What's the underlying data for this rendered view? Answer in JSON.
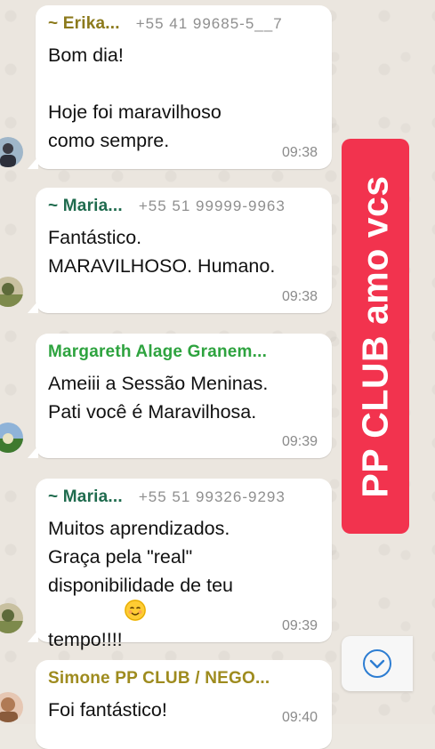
{
  "messages": [
    {
      "sender": "~ Erika...",
      "sender_color": "#8c7a1c",
      "phone": "+55 41 99685-5__7",
      "text": "Bom dia!\n\nHoje foi maravilhoso\ncomo sempre.",
      "time": "09:38"
    },
    {
      "sender": "~ Maria...",
      "sender_color": "#1f6b4e",
      "phone": "+55 51 99999-9963",
      "text": "Fantástico.\nMARAVILHOSO. Humano.",
      "time": "09:38"
    },
    {
      "sender": "Margareth Alage Granem...",
      "sender_color": "#2ea33f",
      "phone": "",
      "text": "Ameiii a Sessão Meninas.\nPati você é Maravilhosa.",
      "time": "09:39"
    },
    {
      "sender": "~ Maria...",
      "sender_color": "#1f6b4e",
      "phone": "+55 51 99326-9293",
      "text": "Muitos aprendizados.\nGraça pela \"real\"\ndisponibilidade de teu\ntempo!!!!",
      "emoji": "smiling-face",
      "time": "09:39"
    },
    {
      "sender": "Simone PP CLUB / NEGO...",
      "sender_color": "#9e8b1e",
      "phone": "",
      "text": "Foi fantástico!",
      "time": "09:40"
    }
  ],
  "sticker": {
    "text": "PP CLUB amo vcs",
    "color": "#f2334e"
  },
  "scroll_button": {
    "icon": "chevron-down-icon",
    "color": "#2d7dd2"
  }
}
